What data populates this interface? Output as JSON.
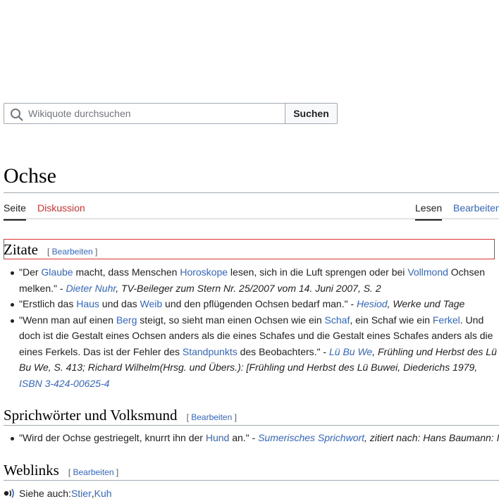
{
  "search": {
    "placeholder": "Wikiquote durchsuchen",
    "button": "Suchen"
  },
  "page": {
    "title": "Ochse"
  },
  "tabs": {
    "seite": "Seite",
    "diskussion": "Diskussion",
    "lesen": "Lesen",
    "bearbeiten": "Bearbeiten"
  },
  "edit_label": "Bearbeiten",
  "sections": {
    "zitate": {
      "heading": "Zitate"
    },
    "sprich": {
      "heading": "Sprichwörter und Volksmund"
    },
    "weblinks": {
      "heading": "Weblinks"
    }
  },
  "q1": {
    "t1": "\"Der ",
    "l1": "Glaube",
    "t2": " macht, dass Menschen ",
    "l2": "Horoskope",
    "t3": " lesen, sich in die Luft sprengen oder bei ",
    "l3": "Vollmond",
    "t4": " Ochsen melken.\" - ",
    "author": "Dieter Nuhr",
    "source": ", TV-Beileger zum Stern Nr. 25/2007 vom 14. Juni 2007, S. 2"
  },
  "q2": {
    "t1": "\"Erstlich das ",
    "l1": "Haus",
    "t2": " und das ",
    "l2": "Weib",
    "t3": " und den pflügenden Ochsen bedarf man.\" - ",
    "author": "Hesiod",
    "source": ", Werke und Tage"
  },
  "q3": {
    "t1": "\"Wenn man auf einen ",
    "l1": "Berg",
    "t2": " steigt, so sieht man einen Ochsen wie ein ",
    "l2": "Schaf",
    "t3": ", ein Schaf wie ein ",
    "l3": "Ferkel",
    "t4": ". Und doch ist die Gestalt eines Ochsen anders als die eines Schafes und die Gestalt eines Schafes anders als die eines Ferkels. Das ist der Fehler des ",
    "l4": "Standpunkts",
    "t5": " des Beobachters.\" - ",
    "author": "Lü Bu We",
    "source": ", Frühling und Herbst des Lü Bu We, S. 413; Richard Wilhelm(Hrsg. und Übers.): [Frühling und Herbst des Lü Buwei, Diederichs 1979, ",
    "isbn": "ISBN 3-424-00625-4"
  },
  "q4": {
    "t1": "\"Wird der Ochse gestriegelt, knurrt ihn der ",
    "l1": "Hund",
    "t2": " an.\" - ",
    "author": "Sumerisches Sprichwort",
    "source": ", zitiert nach: Hans Baumann: Im"
  },
  "weblinks": {
    "prefix": "Siehe auch: ",
    "link1": "Stier",
    "sep": ", ",
    "link2": "Kuh"
  }
}
